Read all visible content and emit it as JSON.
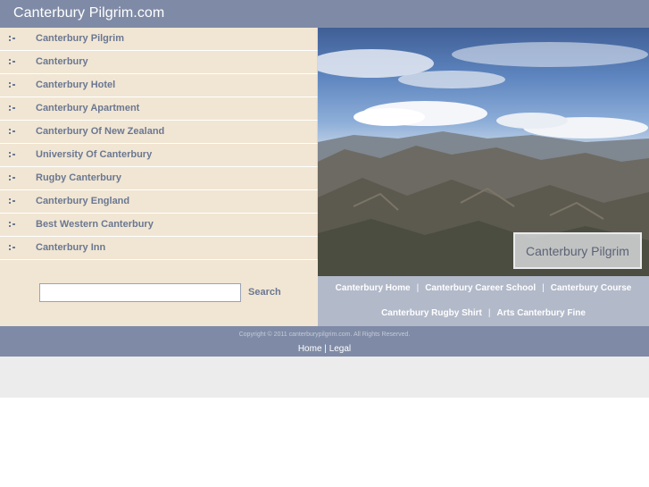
{
  "header": {
    "title": "Canterbury Pilgrim.com"
  },
  "nav": {
    "items": [
      {
        "label": "Canterbury Pilgrim"
      },
      {
        "label": "Canterbury"
      },
      {
        "label": "Canterbury Hotel"
      },
      {
        "label": "Canterbury Apartment"
      },
      {
        "label": "Canterbury Of New Zealand"
      },
      {
        "label": "University Of Canterbury"
      },
      {
        "label": "Rugby Canterbury"
      },
      {
        "label": "Canterbury England"
      },
      {
        "label": "Best Western Canterbury"
      },
      {
        "label": "Canterbury Inn"
      }
    ]
  },
  "search": {
    "value": "",
    "button_label": "Search"
  },
  "hero": {
    "caption": "Canterbury Pilgrim"
  },
  "links": {
    "row1": [
      "Canterbury Home",
      "Canterbury Career School",
      "Canterbury Course"
    ],
    "row2": [
      "Canterbury Rugby Shirt",
      "Arts Canterbury Fine"
    ],
    "separator": "|"
  },
  "footer": {
    "copyright": "Copyright © 2011 canterburypilgrim.com. All Rights Reserved.",
    "links": [
      "Home",
      "Legal"
    ],
    "separator": "|"
  },
  "colors": {
    "header_bg": "#7f8ba6",
    "sidebar_bg": "#f1e6d3",
    "link_text": "#6a7792",
    "links_bar_bg": "#b2b9c9"
  }
}
